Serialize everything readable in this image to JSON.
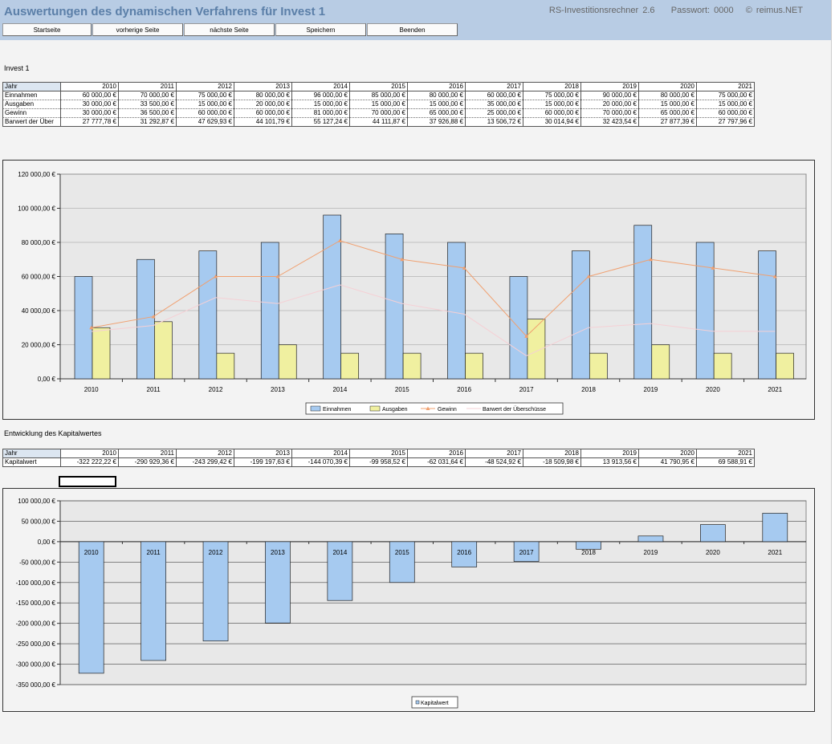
{
  "header": {
    "title": "Auswertungen des dynamischen Verfahrens für Invest 1",
    "app_name": "RS-Investitionsrechner 2.6",
    "password": "Passwort: 0000",
    "copyright": "© reimus.NET"
  },
  "nav": {
    "buttons": [
      "Startseite",
      "vorherige Seite",
      "nächste Seite",
      "Speichern",
      "Beenden"
    ]
  },
  "section1": {
    "title": "Invest 1",
    "table": {
      "header_label": "Jahr",
      "years": [
        "2010",
        "2011",
        "2012",
        "2013",
        "2014",
        "2015",
        "2016",
        "2017",
        "2018",
        "2019",
        "2020",
        "2021"
      ],
      "rows": [
        {
          "label": "Einnahmen",
          "values": [
            "60 000,00 €",
            "70 000,00 €",
            "75 000,00 €",
            "80 000,00 €",
            "96 000,00 €",
            "85 000,00 €",
            "80 000,00 €",
            "60 000,00 €",
            "75 000,00 €",
            "90 000,00 €",
            "80 000,00 €",
            "75 000,00 €"
          ]
        },
        {
          "label": "Ausgaben",
          "values": [
            "30 000,00 €",
            "33 500,00 €",
            "15 000,00 €",
            "20 000,00 €",
            "15 000,00 €",
            "15 000,00 €",
            "15 000,00 €",
            "35 000,00 €",
            "15 000,00 €",
            "20 000,00 €",
            "15 000,00 €",
            "15 000,00 €"
          ]
        },
        {
          "label": "Gewinn",
          "values": [
            "30 000,00 €",
            "36 500,00 €",
            "60 000,00 €",
            "60 000,00 €",
            "81 000,00 €",
            "70 000,00 €",
            "65 000,00 €",
            "25 000,00 €",
            "60 000,00 €",
            "70 000,00 €",
            "65 000,00 €",
            "60 000,00 €"
          ]
        },
        {
          "label": "Barwert der Über",
          "values": [
            "27 777,78 €",
            "31 292,87 €",
            "47 629,93 €",
            "44 101,79 €",
            "55 127,24 €",
            "44 111,87 €",
            "37 926,88 €",
            "13 506,72 €",
            "30 014,94 €",
            "32 423,54 €",
            "27 877,39 €",
            "27 797,96 €"
          ]
        }
      ]
    }
  },
  "section2": {
    "title": "Entwicklung des Kapitalwertes",
    "table": {
      "header_label": "Jahr",
      "years": [
        "2010",
        "2011",
        "2012",
        "2013",
        "2014",
        "2015",
        "2016",
        "2017",
        "2018",
        "2019",
        "2020",
        "2021"
      ],
      "rows": [
        {
          "label": "Kapitalwert",
          "values": [
            "-322 222,22 €",
            "-290 929,36 €",
            "-243 299,42 €",
            "-199 197,63 €",
            "-144 070,39 €",
            "-99 958,52 €",
            "-62 031,64 €",
            "-48 524,92 €",
            "-18 509,98 €",
            "13 913,56 €",
            "41 790,95 €",
            "69 588,91 €"
          ]
        }
      ]
    }
  },
  "colors": {
    "header_bg": "#b8cce4",
    "bar_einnahmen": "#a6caf0",
    "bar_ausgaben": "#f0f0a0",
    "line_gewinn": "#f0a070",
    "line_barwert": "#f5d0d5",
    "bar_kapitalwert": "#a6caf0"
  },
  "chart_data": [
    {
      "type": "bar",
      "categories": [
        "2010",
        "2011",
        "2012",
        "2013",
        "2014",
        "2015",
        "2016",
        "2017",
        "2018",
        "2019",
        "2020",
        "2021"
      ],
      "series": [
        {
          "name": "Einnahmen",
          "kind": "bar",
          "values": [
            60000,
            70000,
            75000,
            80000,
            96000,
            85000,
            80000,
            60000,
            75000,
            90000,
            80000,
            75000
          ]
        },
        {
          "name": "Ausgaben",
          "kind": "bar",
          "values": [
            30000,
            33500,
            15000,
            20000,
            15000,
            15000,
            15000,
            35000,
            15000,
            20000,
            15000,
            15000
          ]
        },
        {
          "name": "Gewinn",
          "kind": "line",
          "values": [
            30000,
            36500,
            60000,
            60000,
            81000,
            70000,
            65000,
            25000,
            60000,
            70000,
            65000,
            60000
          ]
        },
        {
          "name": "Barwert der Überschüsse",
          "kind": "line",
          "values": [
            27777.78,
            31292.87,
            47629.93,
            44101.79,
            55127.24,
            44111.87,
            37926.88,
            13506.72,
            30014.94,
            32423.54,
            27877.39,
            27797.96
          ]
        }
      ],
      "ylim": [
        0,
        120000
      ],
      "yticks": [
        "0,00 €",
        "20 000,00 €",
        "40 000,00 €",
        "60 000,00 €",
        "80 000,00 €",
        "100 000,00 €",
        "120 000,00 €"
      ],
      "grid": true,
      "legend": "bottom"
    },
    {
      "type": "bar",
      "categories": [
        "2010",
        "2011",
        "2012",
        "2013",
        "2014",
        "2015",
        "2016",
        "2017",
        "2018",
        "2019",
        "2020",
        "2021"
      ],
      "series": [
        {
          "name": "Kapitalwert",
          "values": [
            -322222.22,
            -290929.36,
            -243299.42,
            -199197.63,
            -144070.39,
            -99958.52,
            -62031.64,
            -48524.92,
            -18509.98,
            13913.56,
            41790.95,
            69588.91
          ]
        }
      ],
      "ylim": [
        -350000,
        100000
      ],
      "yticks": [
        "-350 000,00 €",
        "-300 000,00 €",
        "-250 000,00 €",
        "-200 000,00 €",
        "-150 000,00 €",
        "-100 000,00 €",
        "-50 000,00 €",
        "0,00 €",
        "50 000,00 €",
        "100 000,00 €"
      ],
      "grid": true,
      "legend": "bottom"
    }
  ]
}
